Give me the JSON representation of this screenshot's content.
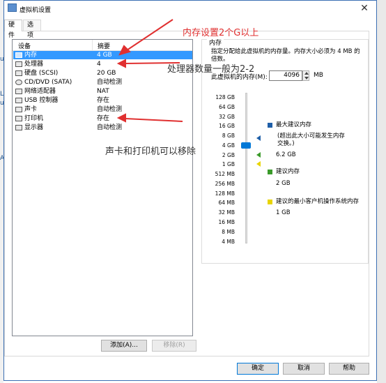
{
  "window": {
    "title": "虚拟机设置",
    "close_glyph": "✕"
  },
  "background": {
    "left_marks": [
      "u",
      "L",
      "u",
      "A"
    ]
  },
  "tabs": [
    {
      "label": "硬件"
    },
    {
      "label": "选项"
    }
  ],
  "device_list": {
    "col_device": "设备",
    "col_summary": "摘要",
    "rows": [
      {
        "name": "内存",
        "summary": "4 GB",
        "icon": "memory-icon",
        "selected": true
      },
      {
        "name": "处理器",
        "summary": "4",
        "icon": "cpu-icon"
      },
      {
        "name": "硬盘 (SCSI)",
        "summary": "20 GB",
        "icon": "hard-disk-icon"
      },
      {
        "name": "CD/DVD (SATA)",
        "summary": "自动检测",
        "icon": "cd-dvd-icon"
      },
      {
        "name": "网络适配器",
        "summary": "NAT",
        "icon": "network-adapter-icon"
      },
      {
        "name": "USB 控制器",
        "summary": "存在",
        "icon": "usb-icon"
      },
      {
        "name": "声卡",
        "summary": "自动检测",
        "icon": "sound-icon"
      },
      {
        "name": "打印机",
        "summary": "存在",
        "icon": "printer-icon"
      },
      {
        "name": "显示器",
        "summary": "自动检测",
        "icon": "monitor-icon"
      }
    ]
  },
  "buttons": {
    "add": "添加(A)...",
    "remove": "移除(R)",
    "ok": "确定",
    "cancel": "取消",
    "help": "帮助"
  },
  "memory": {
    "group_title": "内存",
    "description": "指定分配给此虚拟机的内存量。内存大小必须为 4 MB 的倍数。",
    "label": "此虚拟机的内存(M):",
    "value": "4096",
    "unit": "MB",
    "scale_ticks": [
      "128 GB",
      "64 GB",
      "32 GB",
      "16 GB",
      "8 GB",
      "4 GB",
      "2 GB",
      "1 GB",
      "512 MB",
      "256 MB",
      "128 MB",
      "64 MB",
      "32 MB",
      "16 MB",
      "8 MB",
      "4 MB"
    ],
    "legend": {
      "max": {
        "title": "最大建议内存",
        "note": "(超出此大小可能发生内存交换。)",
        "value": "6.2 GB",
        "color": "#1f5fa8"
      },
      "recommended": {
        "title": "建议内存",
        "value": "2 GB",
        "color": "#3a9a2a"
      },
      "min": {
        "title": "建议的最小客户机操作系统内存",
        "value": "1 GB",
        "color": "#e8d400"
      }
    }
  },
  "annotations": {
    "memory_note": "内存设置2个G以上",
    "cpu_note": "处理器数量一般为2-2",
    "remove_note": "声卡和打印机可以移除",
    "note_color": "#e03030"
  }
}
